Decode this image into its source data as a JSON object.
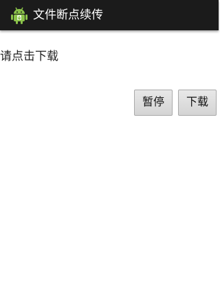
{
  "app": {
    "title": "文件断点续传",
    "icon": "android-icon"
  },
  "main": {
    "status_text": "请点击下载",
    "pause_label": "暂停",
    "download_label": "下载"
  },
  "colors": {
    "action_bar": "#1b1b1b",
    "title_text": "#ffffff",
    "android_green": "#8bc34a",
    "button_bg": "#dcdcdc"
  }
}
